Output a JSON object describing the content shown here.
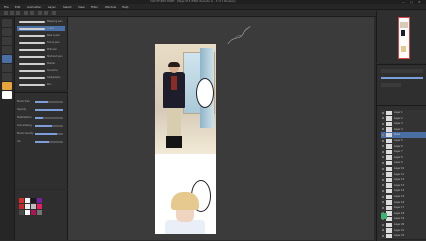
{
  "window": {
    "title": "CLIP STUDIO PAINT - [Page 013 (E001 Episode 1) - 3 of 1 Panel(s)] ",
    "controls": [
      "—",
      "□",
      "✕"
    ]
  },
  "menu": [
    "File",
    "Edit",
    "Animation",
    "Layer",
    "Select",
    "View",
    "Filter",
    "Window",
    "Help"
  ],
  "sub_tool": {
    "brushes": [
      "Mapping pen",
      "G-pen",
      "Real G-pen",
      "Turnip pen",
      "Milli pen",
      "Textured pen",
      "Marker",
      "Gouache",
      "Calligraphy",
      "Pen"
    ]
  },
  "tool_property": {
    "rows": [
      {
        "label": "Brush Size",
        "value": 0.45
      },
      {
        "label": "Opacity",
        "value": 1.0
      },
      {
        "label": "Stabilization",
        "value": 0.3
      },
      {
        "label": "Anti-aliasing",
        "value": 0.6
      },
      {
        "label": "Brush density",
        "value": 0.8
      },
      {
        "label": "Ink",
        "value": 0.5
      }
    ]
  },
  "layers": {
    "items": [
      "Layer 1",
      "Layer 2",
      "Layer 3",
      "Layer 4",
      "Panel",
      "Layer 5",
      "Layer 6",
      "Layer 7",
      "Layer 8",
      "Layer 9",
      "Layer 10",
      "Layer 11",
      "Layer 12",
      "Layer 13",
      "Layer 14",
      "Layer 15",
      "Layer 16",
      "Layer 17",
      "Layer 18",
      "Layer 19",
      "Layer 20",
      "Layer 21",
      "Layer 22"
    ],
    "selected_index": 4
  },
  "colors": {
    "accent": "#4a6fa5",
    "palette": [
      "#d32f2f",
      "#f5f5f5",
      "#1a1a1a",
      "#7b1fa2",
      "#c62828",
      "#eeeeee",
      "#bdbdbd",
      "#e91e63",
      "#4a4a4a",
      "#ffffff",
      "#ad1457",
      "#757575"
    ]
  }
}
